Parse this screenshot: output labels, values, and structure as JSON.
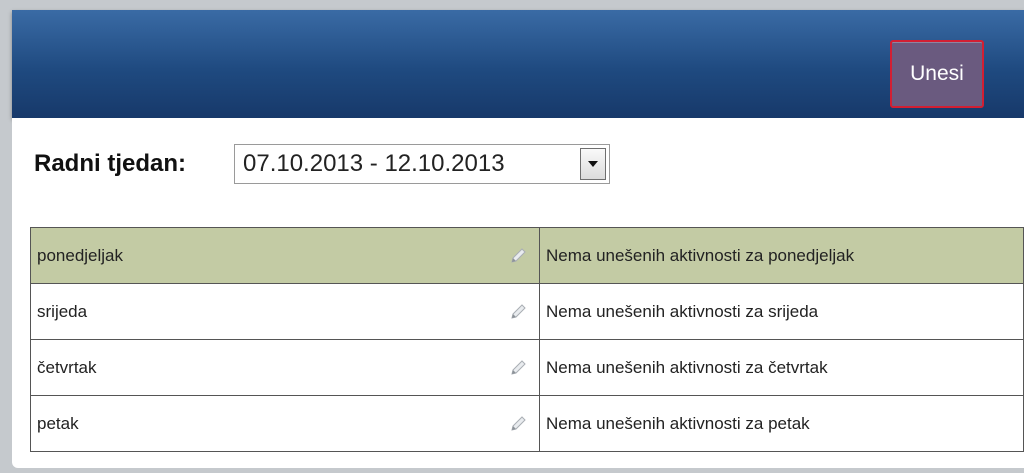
{
  "header": {
    "button_label": "Unesi"
  },
  "week": {
    "label": "Radni tjedan:",
    "selected": "07.10.2013 - 12.10.2013"
  },
  "rows": [
    {
      "day": "ponedjeljak",
      "activity": "Nema unešenih aktivnosti za ponedjeljak",
      "highlighted": true
    },
    {
      "day": "srijeda",
      "activity": "Nema unešenih aktivnosti za srijeda",
      "highlighted": false
    },
    {
      "day": "četvrtak",
      "activity": "Nema unešenih aktivnosti za četvrtak",
      "highlighted": false
    },
    {
      "day": "petak",
      "activity": "Nema unešenih aktivnosti za petak",
      "highlighted": false
    }
  ],
  "colors": {
    "header": "#1f4a80",
    "button": "#6a5a7f",
    "button_border": "#d21f33",
    "highlight_row": "#c3cba4"
  },
  "icons": {
    "edit": "pencil-icon",
    "dropdown": "chevron-down-icon"
  }
}
